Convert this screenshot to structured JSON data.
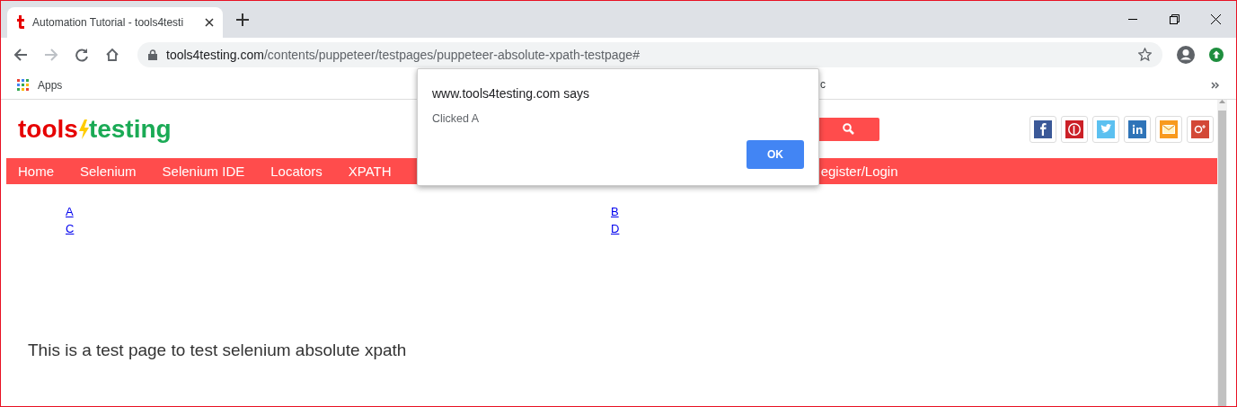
{
  "browser": {
    "tab": {
      "title": "Automation Tutorial - tools4testi",
      "selected": true
    },
    "address": {
      "host": "tools4testing.com",
      "path": "/contents/puppeteer/testpages/puppeteer-absolute-xpath-testpage#"
    },
    "bookmarks": [
      {
        "label": "Apps"
      },
      {
        "label": "c"
      }
    ]
  },
  "page": {
    "logo": {
      "left": "tools",
      "right": "testing"
    },
    "nav": [
      "Home",
      "Selenium",
      "Selenium IDE",
      "Locators",
      "XPATH",
      "egister/Login"
    ],
    "links": [
      "A",
      "B",
      "C",
      "D"
    ],
    "text": "This is a test page to test selenium absolute xpath"
  },
  "dialog": {
    "title": "www.tools4testing.com says",
    "message": "Clicked A",
    "button": "OK"
  }
}
